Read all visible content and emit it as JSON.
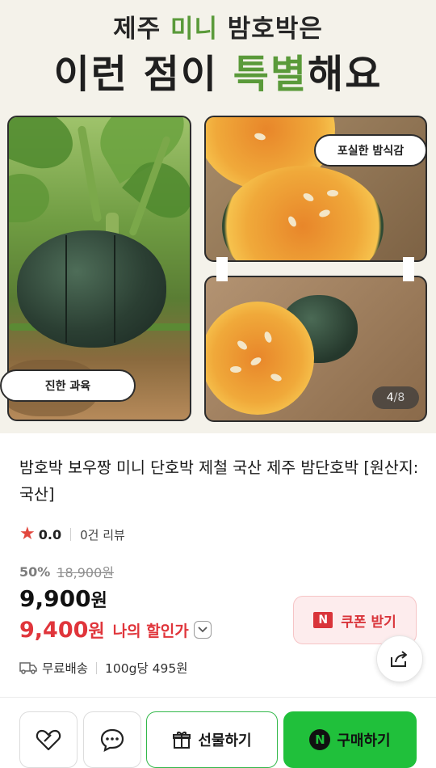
{
  "hero": {
    "subtitle_pre": "제주 ",
    "subtitle_hl": "미니",
    "subtitle_post": " 밤호박은",
    "title_pre": "이런 점이 ",
    "title_hl": "특별",
    "title_post": "해요",
    "bubble_right": "포실한 밤식감",
    "bubble_left": "진한 과육",
    "counter_current": "4",
    "counter_sep": "/",
    "counter_total": "8"
  },
  "product": {
    "title": "밤호박 보우짱 미니 단호박 제철 국산 제주 밤단호박 [원산지:국산]",
    "rating": "0.0",
    "reviews": "0건 리뷰",
    "discount_rate": "50%",
    "original_price": "18,900원",
    "price": "9,900",
    "price_unit": "원",
    "sale_price": "9,400",
    "sale_unit": "원",
    "sale_label": "나의 할인가",
    "coupon_badge": "N",
    "coupon_label": "쿠폰 받기",
    "shipping": "무료배송",
    "unit_price": "100g당 495원"
  },
  "bottom_bar": {
    "gift_label": "선물하기",
    "buy_badge": "N",
    "buy_label": "구매하기"
  },
  "colors": {
    "accent_green": "#5a9a3a",
    "sale_red": "#e0353b",
    "buy_green": "#20c03b"
  },
  "icons": [
    "star-icon",
    "chevron-down-icon",
    "truck-icon",
    "share-icon",
    "heart-icon",
    "chat-icon",
    "gift-icon"
  ]
}
